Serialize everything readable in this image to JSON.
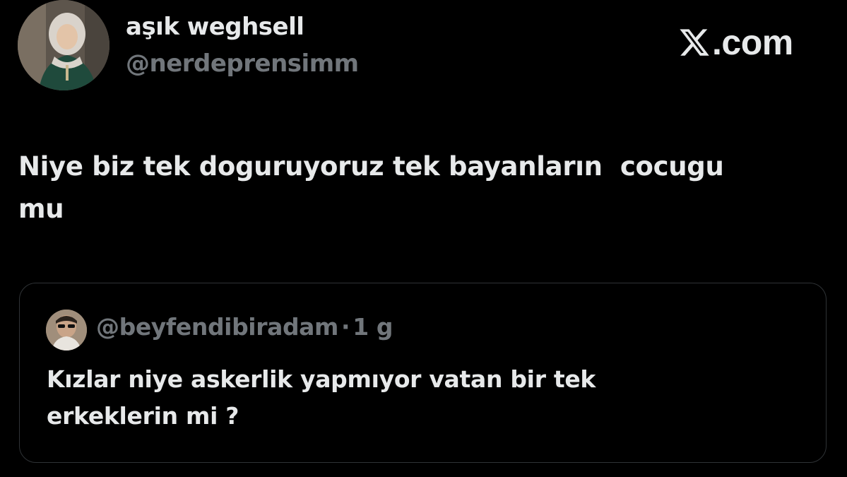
{
  "brand": {
    "text": ".com",
    "logo_icon": "x-logo-icon"
  },
  "author": {
    "display_name": "aşık weghsell",
    "handle": "@nerdeprensimm",
    "avatar_icon": "profile-avatar"
  },
  "tweet": {
    "text": "Niye biz tek doguruyoruz tek bayanların  cocugu\nmu"
  },
  "quoted_tweet": {
    "handle": "@beyfendibiradam",
    "separator": "·",
    "time": "1 g",
    "text": "Kızlar niye askerlik yapmıyor vatan bir tek\nerkeklerin mi ?",
    "avatar_icon": "quoted-avatar"
  },
  "colors": {
    "background": "#000000",
    "primary_text": "#e7e9ea",
    "secondary_text": "#71767b",
    "border": "#2f3336"
  }
}
